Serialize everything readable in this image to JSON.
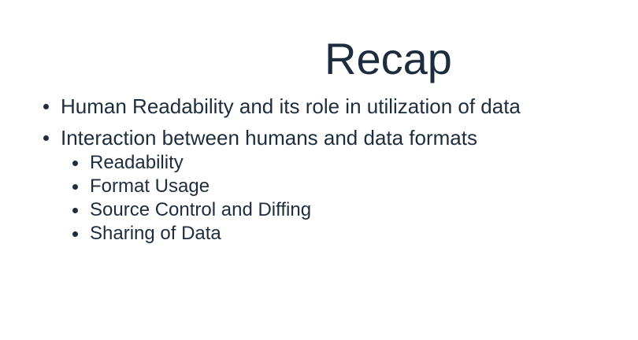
{
  "slide": {
    "title": "Recap",
    "bullets": [
      "Human Readability and its role in utilization of data",
      "Interaction between humans and data formats"
    ],
    "sub_bullets": [
      "Readability",
      "Format Usage",
      "Source Control and Diffing",
      "Sharing of Data"
    ]
  },
  "colors": {
    "text": "#1e2d3d",
    "background": "#ffffff"
  }
}
